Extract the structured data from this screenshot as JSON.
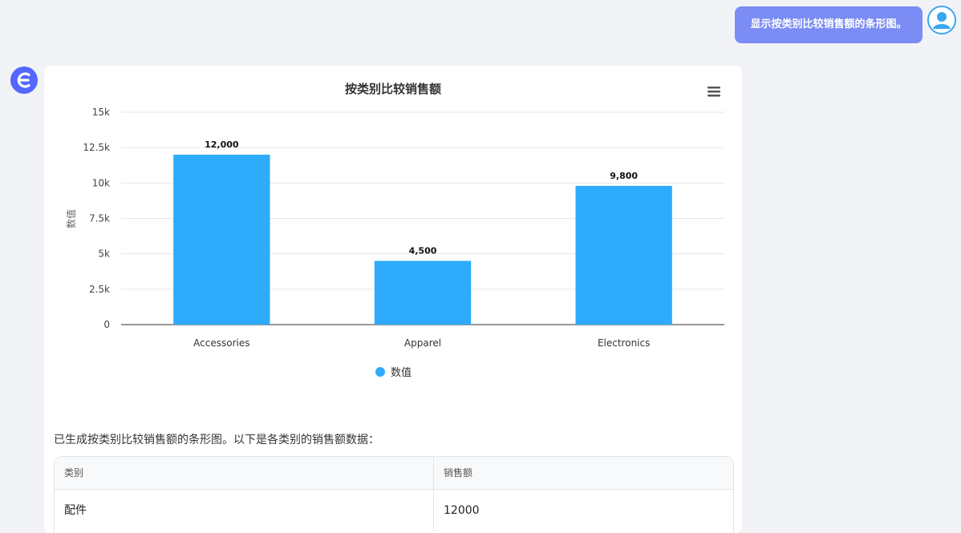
{
  "user_message": "显示按类别比较销售额的条形图。",
  "colors": {
    "accent": "#7b8cf5",
    "bar": "#2eabfa",
    "bot_avatar": "#5468ff",
    "user_avatar": "#3aa7f0"
  },
  "icons": {
    "user_avatar": "user-avatar-icon",
    "bot_avatar": "bot-logo-icon",
    "menu": "hamburger-menu-icon"
  },
  "chart_data": {
    "type": "bar",
    "title": "按类别比较销售额",
    "ylabel": "数值",
    "xlabel": "",
    "categories": [
      "Accessories",
      "Apparel",
      "Electronics"
    ],
    "series": [
      {
        "name": "数值",
        "values": [
          12000,
          4500,
          9800
        ]
      }
    ],
    "data_labels": [
      "12,000",
      "4,500",
      "9,800"
    ],
    "ylim": [
      0,
      15000
    ],
    "yticks": [
      0,
      2500,
      5000,
      7500,
      10000,
      12500,
      15000
    ],
    "ytick_labels": [
      "0",
      "2.5k",
      "5k",
      "7.5k",
      "10k",
      "12.5k",
      "15k"
    ],
    "grid": true,
    "legend": "bottom-center"
  },
  "summary_text": "已生成按类别比较销售额的条形图。以下是各类别的销售额数据：",
  "table": {
    "headers": [
      "类别",
      "销售额"
    ],
    "rows": [
      [
        "配件",
        "12000"
      ]
    ]
  }
}
